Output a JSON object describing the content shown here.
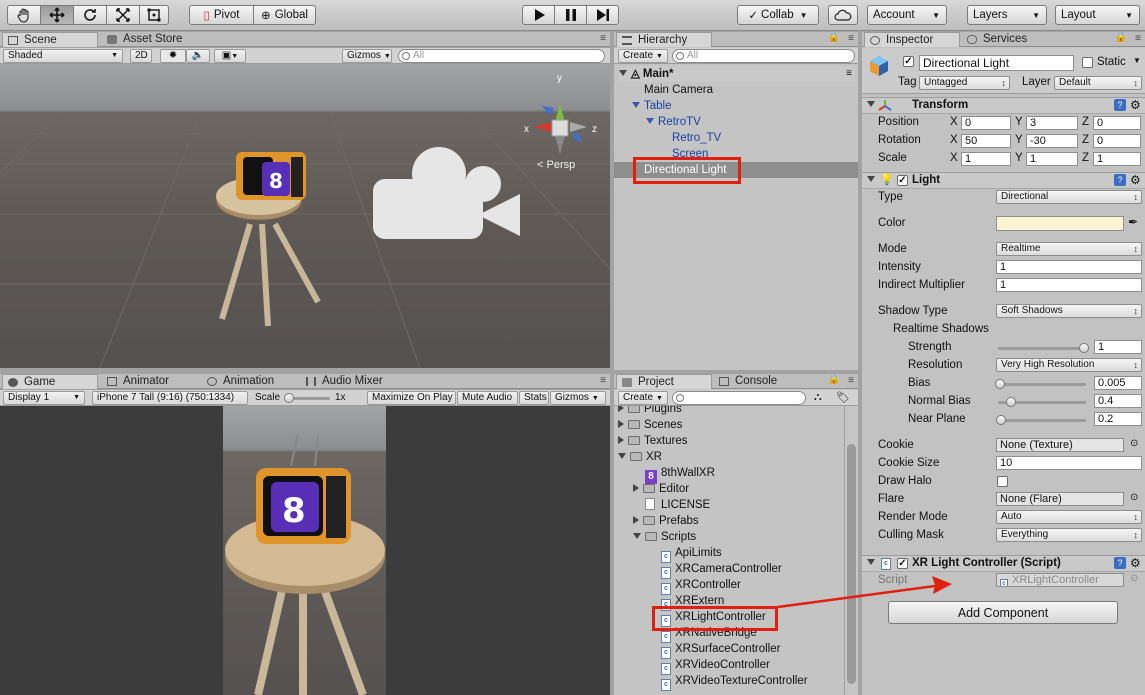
{
  "toolbar": {
    "pivot_label": "Pivot",
    "global_label": "Global",
    "collab_label": "Collab",
    "account_label": "Account",
    "layers_label": "Layers",
    "layout_label": "Layout"
  },
  "scene": {
    "tab_label": "Scene",
    "asset_store_label": "Asset Store",
    "shading_value": "Shaded",
    "mode_2d": "2D",
    "gizmos_label": "Gizmos",
    "search_placeholder": "All",
    "persp_label": "Persp",
    "axis_y": "y",
    "axis_x": "x",
    "axis_z": "z"
  },
  "game": {
    "tabs": [
      "Game",
      "Animator",
      "Animation",
      "Audio Mixer"
    ],
    "display_value": "Display 1",
    "resolution_value": "iPhone 7 Tall (9:16) (750:1334)",
    "scale_label": "Scale",
    "scale_value": "1x",
    "maximize_label": "Maximize On Play",
    "mute_label": "Mute Audio",
    "stats_label": "Stats",
    "gizmos_label": "Gizmos"
  },
  "hierarchy": {
    "tab_label": "Hierarchy",
    "create_label": "Create",
    "search_placeholder": "All",
    "scene_name": "Main*",
    "items": [
      {
        "label": "Main Camera",
        "color": "black"
      },
      {
        "label": "Table",
        "color": "blue"
      },
      {
        "label": "RetroTV",
        "color": "blue"
      },
      {
        "label": "Retro_TV",
        "color": "blue"
      },
      {
        "label": "Screen",
        "color": "blue"
      },
      {
        "label": "Directional Light",
        "color": "white"
      }
    ]
  },
  "project": {
    "tab_label": "Project",
    "console_label": "Console",
    "create_label": "Create",
    "items": [
      {
        "label": "Plugins",
        "type": "folder"
      },
      {
        "label": "Scenes",
        "type": "folder"
      },
      {
        "label": "Textures",
        "type": "folder"
      },
      {
        "label": "XR",
        "type": "folder"
      },
      {
        "label": "8thWallXR",
        "type": "asset"
      },
      {
        "label": "Editor",
        "type": "folder"
      },
      {
        "label": "LICENSE",
        "type": "file"
      },
      {
        "label": "Prefabs",
        "type": "folder"
      },
      {
        "label": "Scripts",
        "type": "folder"
      },
      {
        "label": "ApiLimits",
        "type": "script"
      },
      {
        "label": "XRCameraController",
        "type": "script"
      },
      {
        "label": "XRController",
        "type": "script"
      },
      {
        "label": "XRExtern",
        "type": "script"
      },
      {
        "label": "XRLightController",
        "type": "script"
      },
      {
        "label": "XRNativeBridge",
        "type": "script"
      },
      {
        "label": "XRSurfaceController",
        "type": "script"
      },
      {
        "label": "XRVideoController",
        "type": "script"
      },
      {
        "label": "XRVideoTextureController",
        "type": "script"
      }
    ]
  },
  "inspector": {
    "tab_label": "Inspector",
    "services_label": "Services",
    "object_name": "Directional Light",
    "static_label": "Static",
    "tag_label": "Tag",
    "tag_value": "Untagged",
    "layer_label": "Layer",
    "layer_value": "Default",
    "transform": {
      "title": "Transform",
      "position_label": "Position",
      "rotation_label": "Rotation",
      "scale_label": "Scale",
      "axis_labels": [
        "X",
        "Y",
        "Z"
      ],
      "position": [
        "0",
        "3",
        "0"
      ],
      "rotation": [
        "50",
        "-30",
        "0"
      ],
      "scale": [
        "1",
        "1",
        "1"
      ]
    },
    "light": {
      "title": "Light",
      "type_label": "Type",
      "type_value": "Directional",
      "color_label": "Color",
      "color_value": "#fdf4d6",
      "mode_label": "Mode",
      "mode_value": "Realtime",
      "intensity_label": "Intensity",
      "intensity_value": "1",
      "indirect_label": "Indirect Multiplier",
      "indirect_value": "1",
      "shadow_type_label": "Shadow Type",
      "shadow_type_value": "Soft Shadows",
      "realtime_shadows_label": "Realtime Shadows",
      "strength_label": "Strength",
      "strength_value": "1",
      "resolution_label": "Resolution",
      "resolution_value": "Very High Resolution",
      "bias_label": "Bias",
      "bias_value": "0.005",
      "normal_bias_label": "Normal Bias",
      "normal_bias_value": "0.4",
      "near_plane_label": "Near Plane",
      "near_plane_value": "0.2",
      "cookie_label": "Cookie",
      "cookie_value": "None (Texture)",
      "cookie_size_label": "Cookie Size",
      "cookie_size_value": "10",
      "draw_halo_label": "Draw Halo",
      "flare_label": "Flare",
      "flare_value": "None (Flare)",
      "render_mode_label": "Render Mode",
      "render_mode_value": "Auto",
      "culling_mask_label": "Culling Mask",
      "culling_mask_value": "Everything"
    },
    "script_component": {
      "title": "XR Light Controller (Script)",
      "script_label": "Script",
      "script_value": "XRLightController"
    },
    "add_component_label": "Add Component"
  },
  "colors": {
    "highlight_red": "#e01f0f",
    "selection_gray": "#8e8e8e",
    "hierarchy_blue": "#1b3fa3"
  }
}
